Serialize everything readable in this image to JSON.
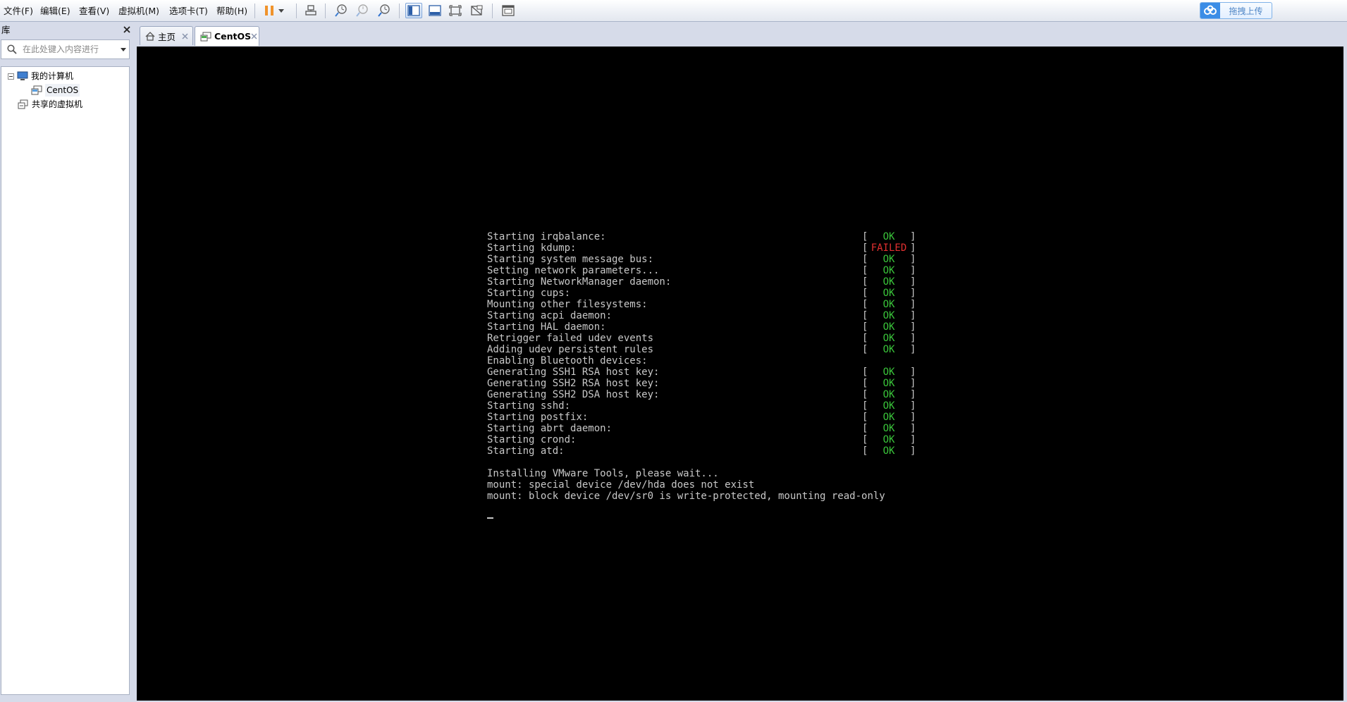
{
  "menu": {
    "file": "文件(F)",
    "edit": "编辑(E)",
    "view": "查看(V)",
    "vm": "虚拟机(M)",
    "tabs": "选项卡(T)",
    "help": "帮助(H)"
  },
  "toolbar": {
    "upload_label": "拖拽上传",
    "colors": {
      "pause": "#f0932b",
      "accent": "#3b8de6"
    }
  },
  "library": {
    "title": "库",
    "search_placeholder": "在此处键入内容进行",
    "tree": {
      "my_computer": "我的计算机",
      "vm_centos": "CentOS",
      "shared": "共享的虚拟机"
    }
  },
  "tabs": [
    {
      "label": "主页"
    },
    {
      "label": "CentOS"
    }
  ],
  "console": {
    "boot_lines": [
      {
        "msg": "Starting irqbalance:",
        "status": "OK"
      },
      {
        "msg": "Starting kdump:",
        "status": "FAILED"
      },
      {
        "msg": "Starting system message bus:",
        "status": "OK"
      },
      {
        "msg": "Setting network parameters...",
        "status": "OK"
      },
      {
        "msg": "Starting NetworkManager daemon:",
        "status": "OK"
      },
      {
        "msg": "Starting cups:",
        "status": "OK"
      },
      {
        "msg": "Mounting other filesystems:",
        "status": "OK"
      },
      {
        "msg": "Starting acpi daemon:",
        "status": "OK"
      },
      {
        "msg": "Starting HAL daemon:",
        "status": "OK"
      },
      {
        "msg": "Retrigger failed udev events",
        "status": "OK"
      },
      {
        "msg": "Adding udev persistent rules",
        "status": "OK"
      },
      {
        "msg": "Enabling Bluetooth devices:",
        "status": ""
      },
      {
        "msg": "Generating SSH1 RSA host key:",
        "status": "OK"
      },
      {
        "msg": "Generating SSH2 RSA host key:",
        "status": "OK"
      },
      {
        "msg": "Generating SSH2 DSA host key:",
        "status": "OK"
      },
      {
        "msg": "Starting sshd:",
        "status": "OK"
      },
      {
        "msg": "Starting postfix:",
        "status": "OK"
      },
      {
        "msg": "Starting abrt daemon:",
        "status": "OK"
      },
      {
        "msg": "Starting crond:",
        "status": "OK"
      },
      {
        "msg": "Starting atd:",
        "status": "OK"
      },
      {
        "msg": "",
        "status": ""
      },
      {
        "msg": "Installing VMware Tools, please wait...",
        "status": ""
      },
      {
        "msg": "mount: special device /dev/hda does not exist",
        "status": ""
      },
      {
        "msg": "mount: block device /dev/sr0 is write-protected, mounting read-only",
        "status": ""
      }
    ],
    "colors": {
      "ok": "#3ac43a",
      "failed": "#e23030",
      "text": "#c8c8c8"
    }
  }
}
